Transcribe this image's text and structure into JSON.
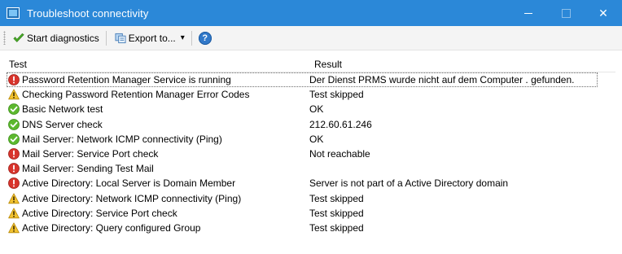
{
  "window": {
    "title": "Troubleshoot connectivity",
    "app_icon": "network-monitor-icon",
    "controls": {
      "minimize": "minimize-icon",
      "maximize": "maximize-icon",
      "close": "close-icon"
    },
    "close_glyph": "✕"
  },
  "toolbar": {
    "start_label": "Start diagnostics",
    "start_icon": "green-checkmark-icon",
    "export_label": "Export to...",
    "export_icon": "export-icon",
    "dropdown_glyph": "▾",
    "help_glyph": "?",
    "help_icon": "help-icon"
  },
  "list": {
    "columns": [
      "Test",
      "Result"
    ],
    "rows": [
      {
        "status": "error",
        "test": "Password Retention Manager Service is running",
        "result": "Der Dienst PRMS wurde nicht auf dem Computer . gefunden.",
        "selected": true
      },
      {
        "status": "warning",
        "test": "Checking Password Retention Manager Error Codes",
        "result": "Test skipped"
      },
      {
        "status": "ok",
        "test": "Basic Network test",
        "result": "OK"
      },
      {
        "status": "ok",
        "test": "DNS Server check",
        "result": "212.60.61.246"
      },
      {
        "status": "ok",
        "test": "Mail Server: Network ICMP connectivity (Ping)",
        "result": "OK"
      },
      {
        "status": "error",
        "test": "Mail Server: Service Port check",
        "result": "Not reachable"
      },
      {
        "status": "error",
        "test": "Mail Server: Sending Test Mail",
        "result": ""
      },
      {
        "status": "error",
        "test": "Active Directory: Local Server is Domain Member",
        "result": "Server is not part of a Active Directory domain"
      },
      {
        "status": "warning",
        "test": "Active Directory: Network ICMP connectivity (Ping)",
        "result": "Test skipped"
      },
      {
        "status": "warning",
        "test": "Active Directory: Service Port check",
        "result": "Test skipped"
      },
      {
        "status": "warning",
        "test": "Active Directory: Query configured Group",
        "result": "Test skipped"
      }
    ]
  },
  "status_icons": {
    "ok": "success-check-icon",
    "warning": "warning-triangle-icon",
    "error": "error-exclamation-icon"
  },
  "colors": {
    "titlebar": "#2b88d8",
    "ok": "#5cb82e",
    "warning": "#f2c230",
    "error": "#d8342c",
    "help": "#3279c9"
  }
}
